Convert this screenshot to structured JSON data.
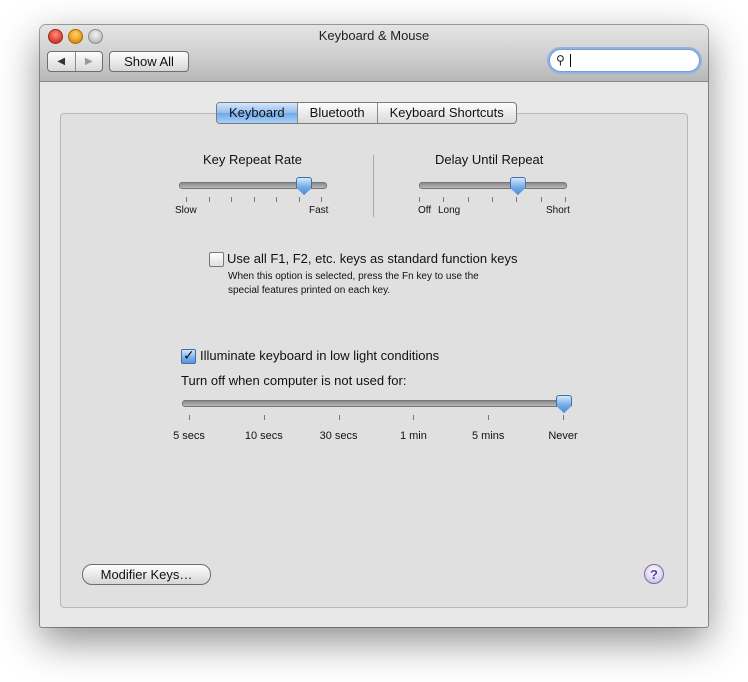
{
  "window": {
    "title": "Keyboard & Mouse",
    "back_icon": "◀",
    "forward_icon": "▶",
    "show_all_label": "Show All",
    "search_icon": "🔍"
  },
  "tabs": [
    {
      "label": "Keyboard",
      "active": true
    },
    {
      "label": "Bluetooth",
      "active": false
    },
    {
      "label": "Keyboard Shortcuts",
      "active": false
    }
  ],
  "key_repeat": {
    "title": "Key Repeat Rate",
    "min_label": "Slow",
    "max_label": "Fast",
    "level_fraction": 0.85
  },
  "delay_repeat": {
    "title": "Delay Until Repeat",
    "off_label": "Off",
    "long_label": "Long",
    "short_label": "Short",
    "level_fraction": 0.67
  },
  "function_keys": {
    "label": "Use all F1, F2, etc. keys as standard function keys",
    "checked": false,
    "description_line1": "When this option is selected, press the Fn key to use the",
    "description_line2": "special features printed on each key."
  },
  "illuminate": {
    "label": "Illuminate keyboard in low light conditions",
    "checked": true,
    "check_glyph": "✓",
    "turn_off_label": "Turn off when computer is not used for:",
    "options": [
      "5 secs",
      "10 secs",
      "30 secs",
      "1 min",
      "5 mins",
      "Never"
    ],
    "selected": "Never"
  },
  "footer": {
    "modifier_keys_label": "Modifier Keys…",
    "help_glyph": "?"
  },
  "colors": {
    "accent": "#6fa8e8",
    "close": "#e24b3a",
    "minimize": "#f0a020",
    "zoom": "#c8c8c8"
  }
}
